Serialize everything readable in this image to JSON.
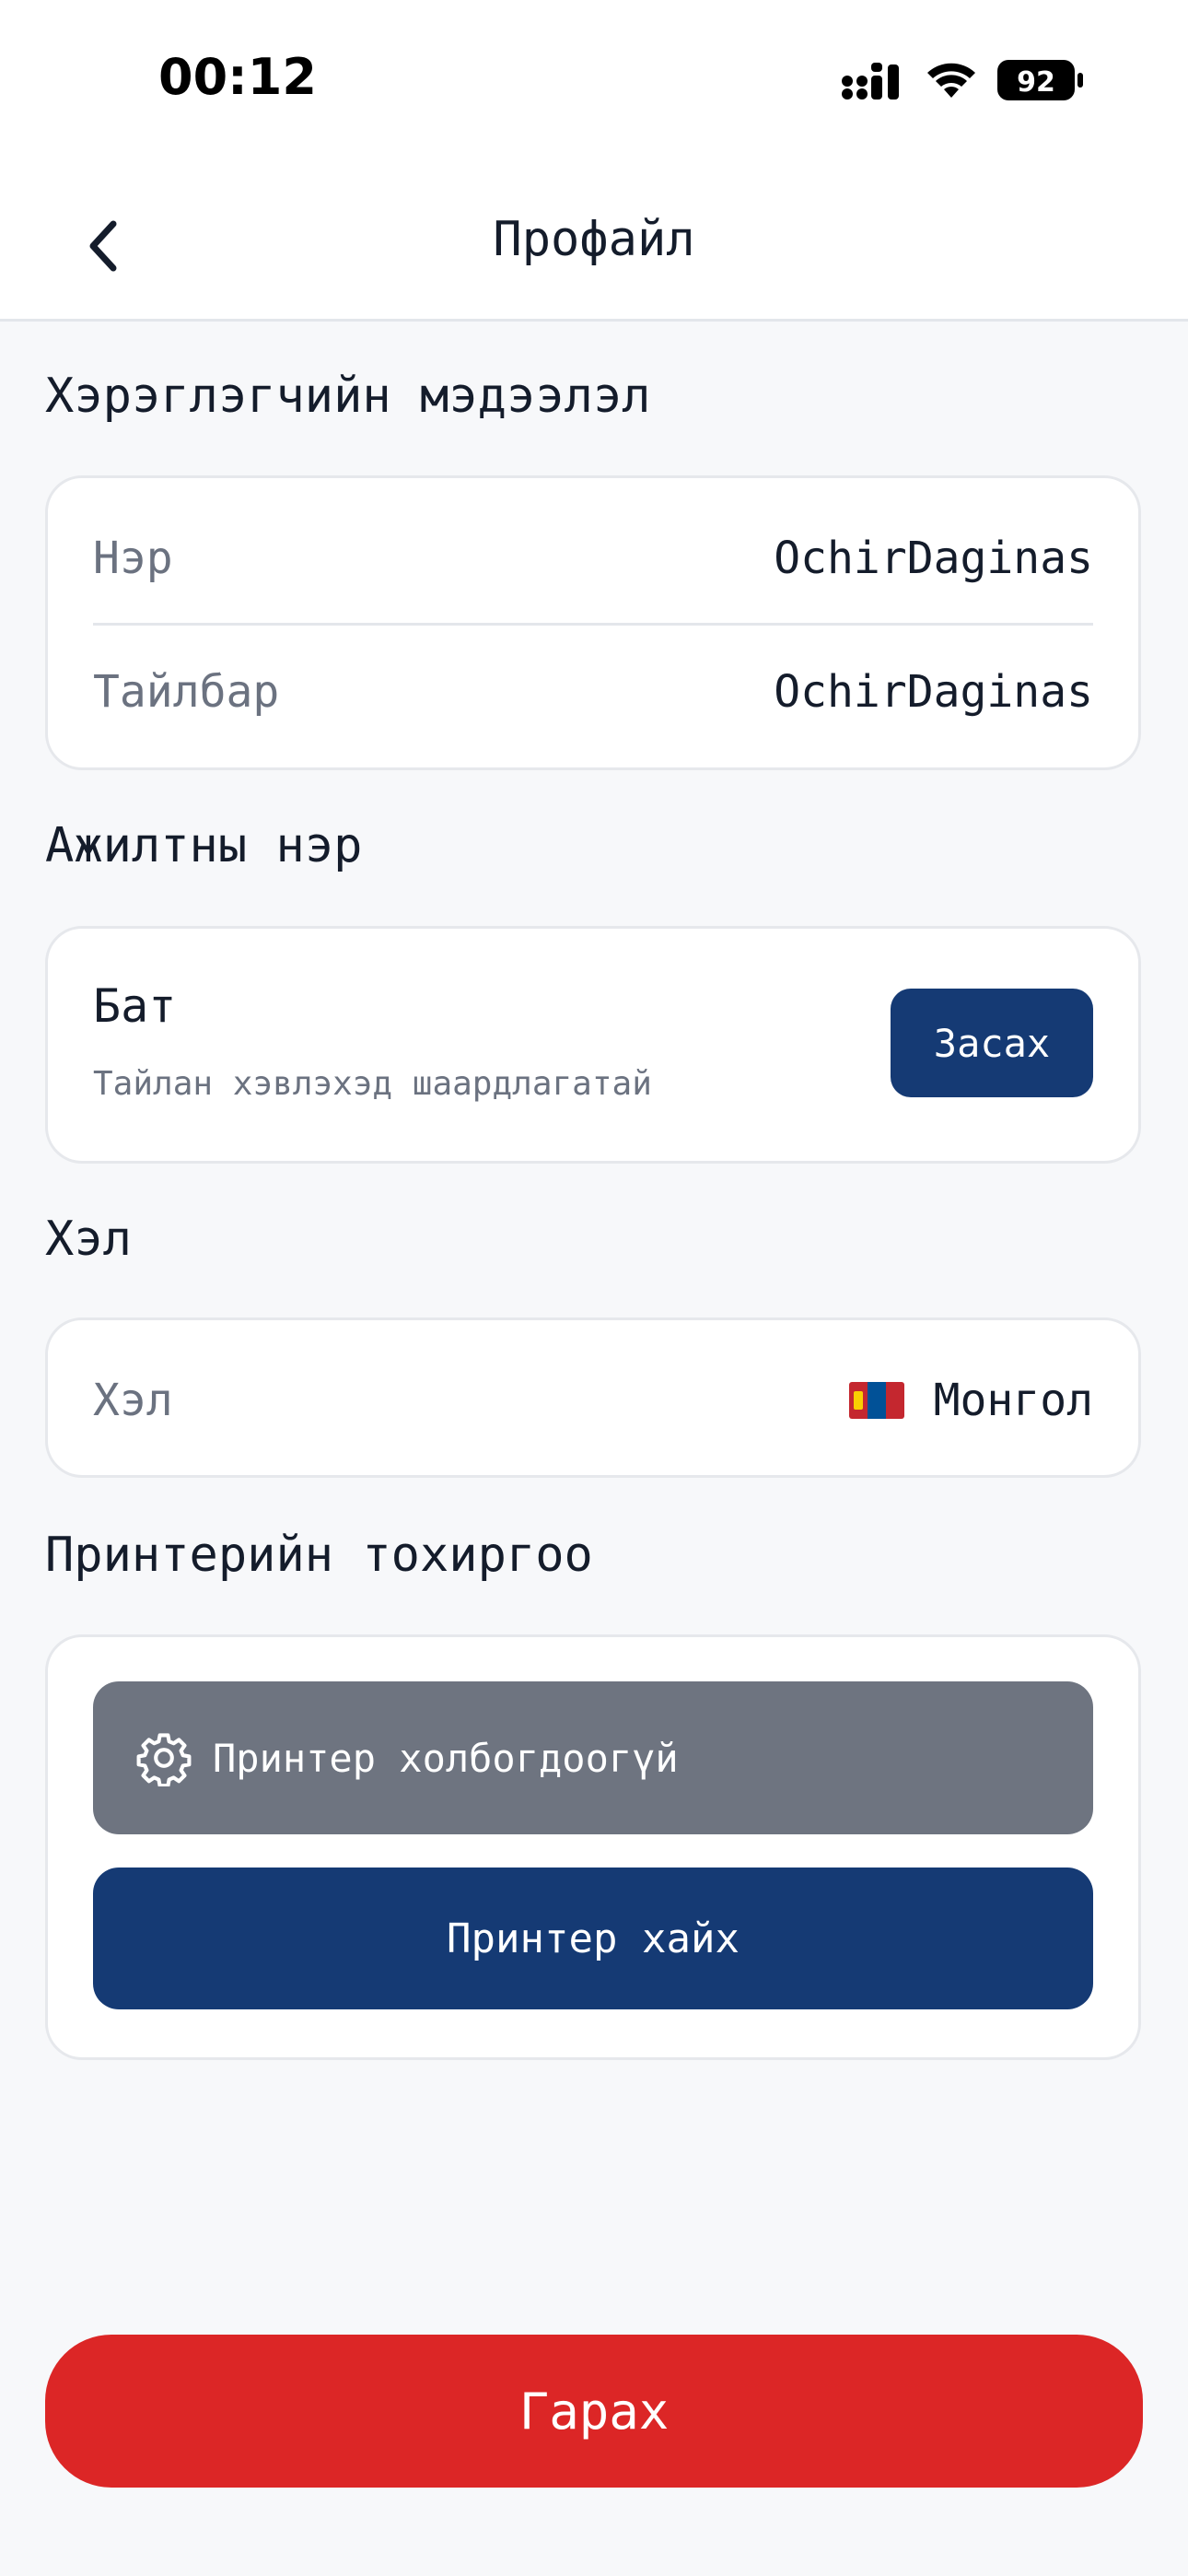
{
  "status_bar": {
    "time": "00:12",
    "battery": "92"
  },
  "header": {
    "title": "Профайл",
    "back_icon": "chevron-left-icon"
  },
  "user_info": {
    "title": "Хэрэглэгчийн мэдээлэл",
    "rows": [
      {
        "label": "Нэр",
        "value": "OchirDaginas"
      },
      {
        "label": "Тайлбар",
        "value": "OchirDaginas"
      }
    ]
  },
  "employee": {
    "title": "Ажилтны нэр",
    "name": "Бат",
    "subtitle": "Тайлан хэвлэхэд шаардлагатай",
    "edit_label": "Засах"
  },
  "language": {
    "title": "Хэл",
    "label": "Хэл",
    "value": "Монгол",
    "flag_colors": [
      "#c4272f",
      "#015197",
      "#c4272f"
    ],
    "flag_emblem_color": "#f9cf02"
  },
  "printer": {
    "title": "Принтерийн тохиргоо",
    "status": "Принтер холбогдоогүй",
    "status_icon": "gear-icon",
    "find_label": "Принтер хайх"
  },
  "logout": {
    "label": "Гарах"
  },
  "colors": {
    "primary": "#153a74",
    "danger": "#dc2626",
    "muted_button": "#6e7480",
    "background": "#f7f8fa",
    "muted_text": "#6b7280"
  }
}
